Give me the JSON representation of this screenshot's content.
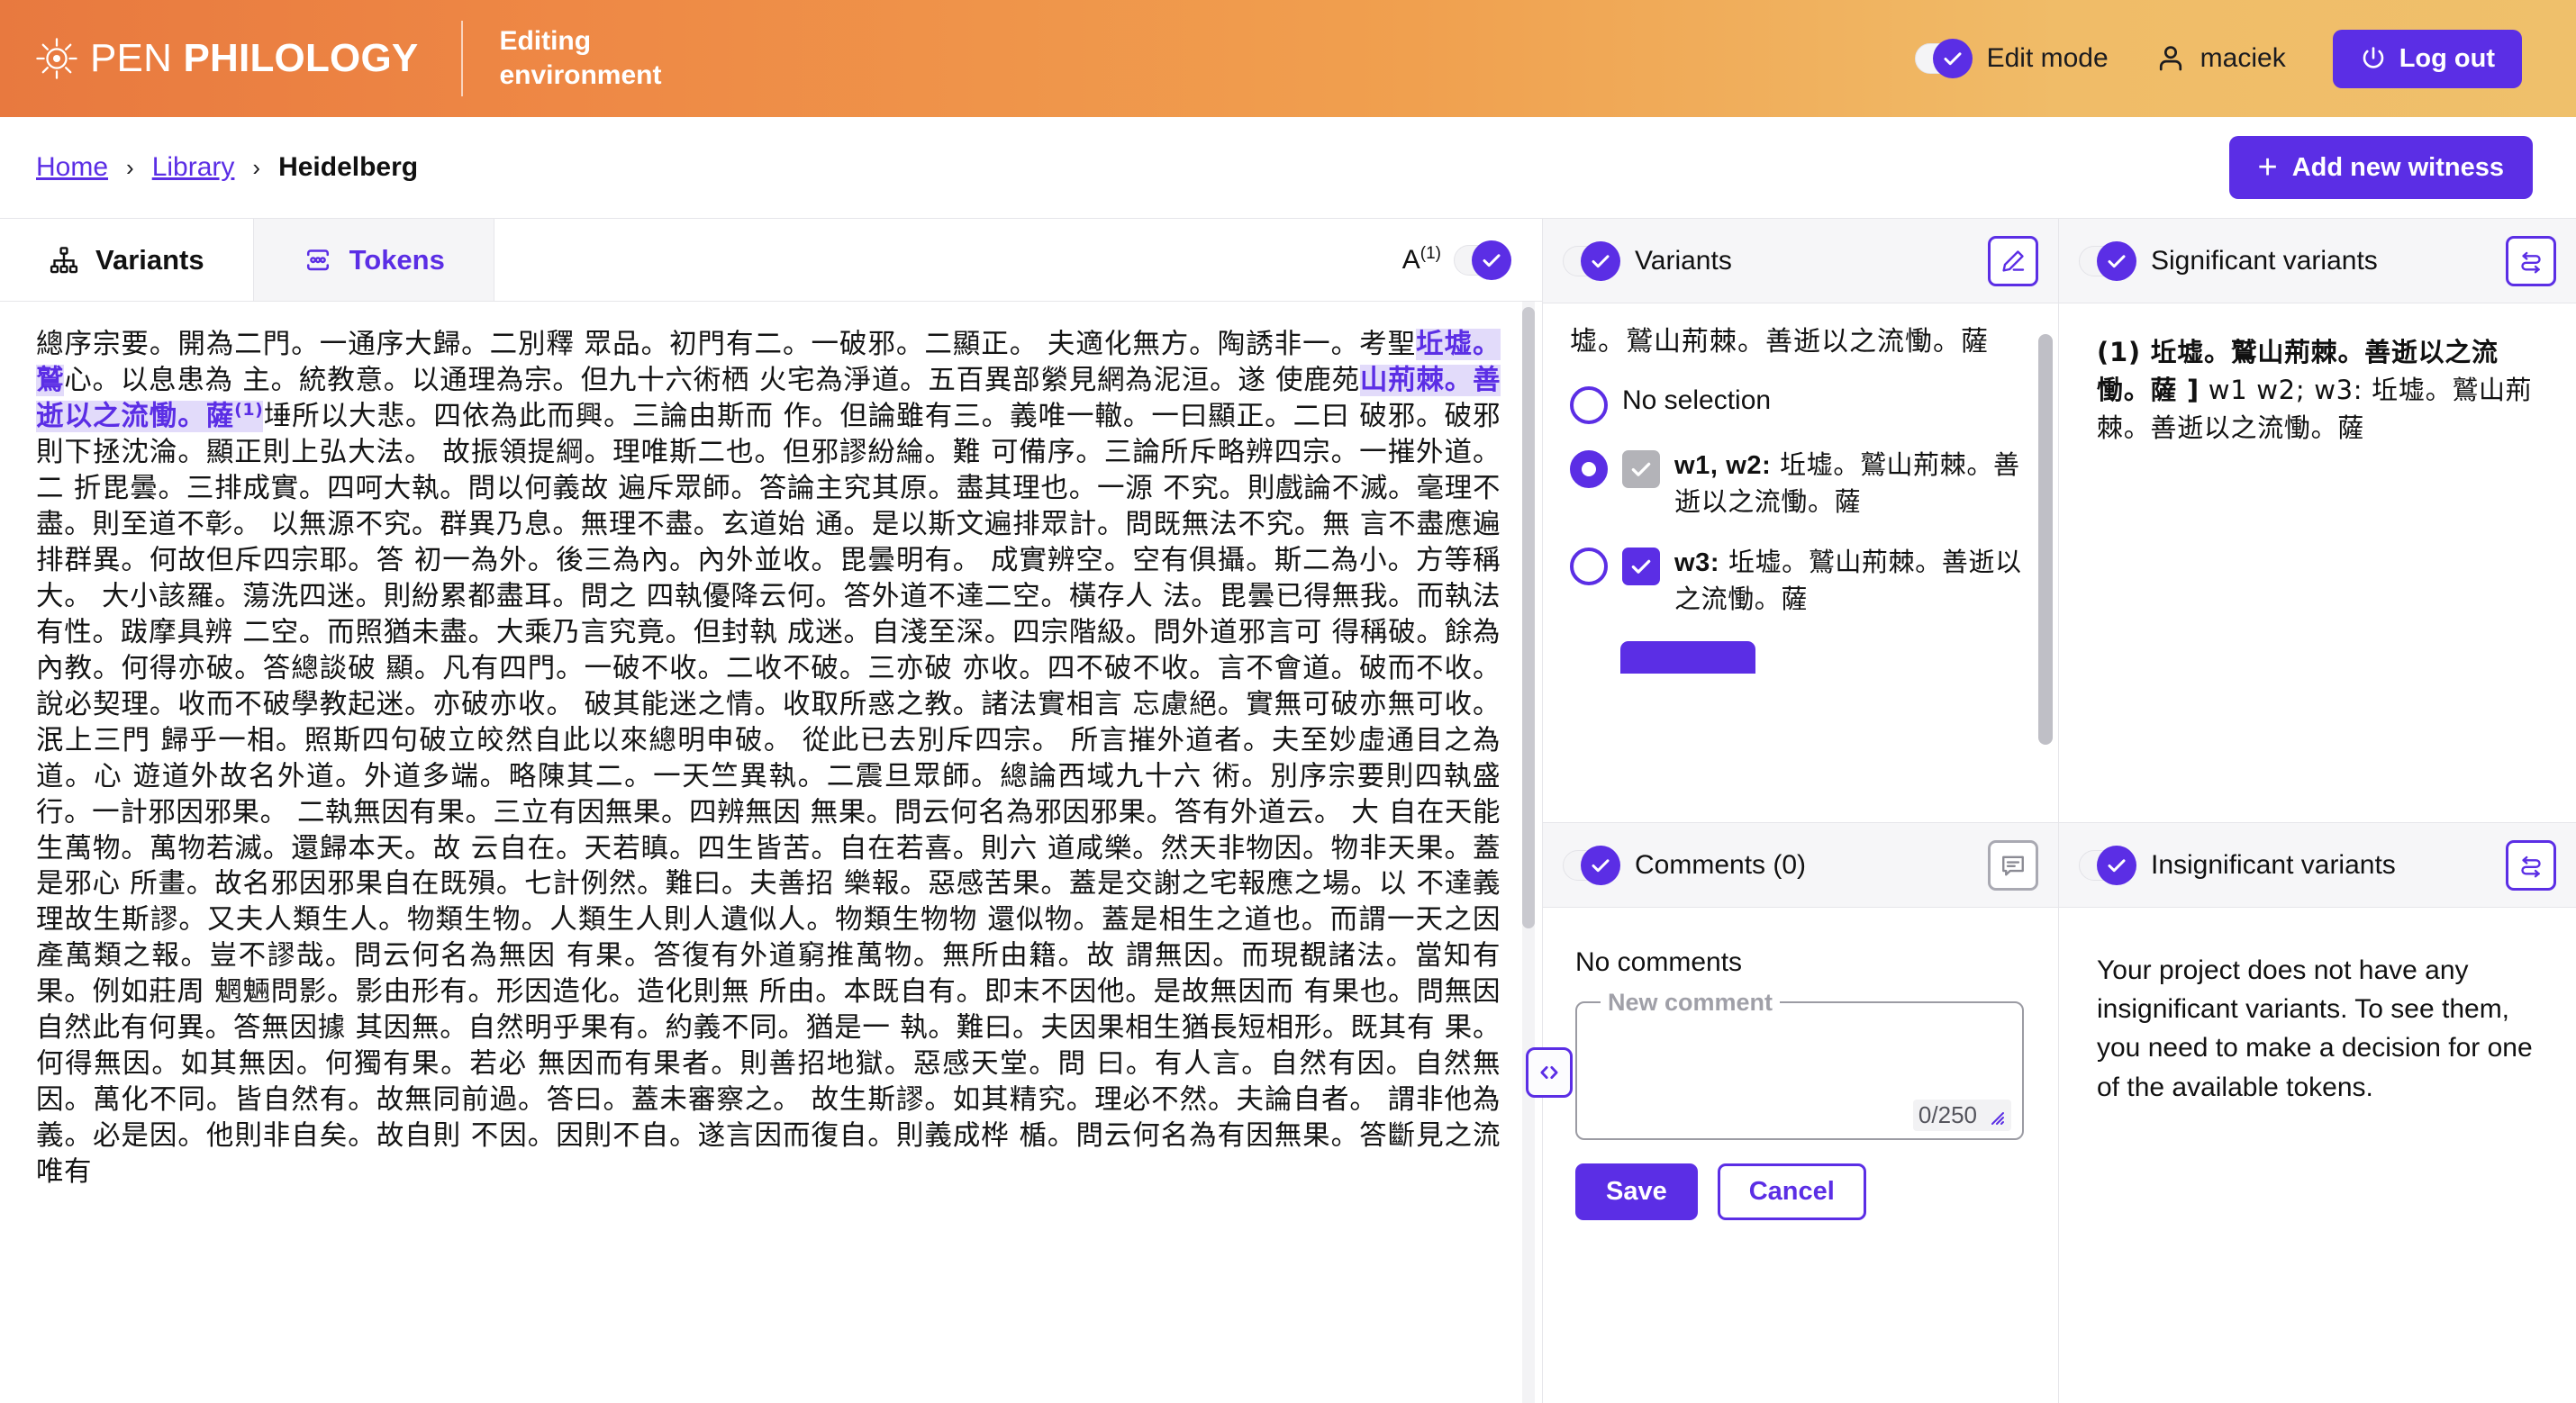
{
  "header": {
    "logo_open": "PEN ",
    "logo_philology": "PHILOLOGY",
    "logo_icon": "sun-asterisk-icon",
    "subtitle": "Editing environment",
    "edit_mode_label": "Edit mode",
    "edit_mode_on": true,
    "username": "maciek",
    "logout_label": "Log out",
    "accent_purple": "#5B2EE5",
    "gradient_start": "#e8793f",
    "gradient_end": "#efc06b"
  },
  "breadcrumb": {
    "items": [
      {
        "label": "Home",
        "current": false
      },
      {
        "label": "Library",
        "current": false
      },
      {
        "label": "Heidelberg",
        "current": true
      }
    ],
    "separator": "›",
    "add_witness_label": "Add new witness"
  },
  "tabs": {
    "items": [
      {
        "label": "Variants",
        "icon": "hierarchy-icon",
        "active": true
      },
      {
        "label": "Tokens",
        "icon": "tokens-icon",
        "active": false
      }
    ],
    "apparatus_label": "A",
    "apparatus_sup": "(1)",
    "apparatus_toggle_on": true
  },
  "main_text": {
    "lines": [
      "總序宗要。開為二門。一通序大歸。二別釋 眾品。初門有二。一破邪。二顯正。 夫適化無方。陶誘非一。考聖",
      "心。以息患為 主。統教意。以通理為宗。但九十六術栖 火宅為淨道。五百異部縈見網為泥洹。遂 使鹿苑",
      "埵所以大悲。四依為此而興。三論由斯而 作。但論雖有三。義唯一轍。一曰顯正。",
      "二曰 破邪。破邪則下拯沈淪。顯正則上弘大法。 故振領提綱。理唯斯二也。但邪謬紛綸。難 可備序。三論所斥略",
      "辨四宗。一摧外道。二 折毘曇。三排成實。四呵大執。問以何義故 遍斥眾師。答論主究其原。盡其理也。一源 不",
      "究。則戲論不滅。毫理不盡。則至道不彰。 以無源不究。群異乃息。無理不盡。玄道始 通。是以斯文遍排眾計。",
      "問既無法不究。無 言不盡應遍排群異。何故但斥四宗耶。答 初一為外。後三為內。內外並收。毘曇明有。 成實辨",
      "空。空有俱攝。斯二為小。方等稱大。 大小該羅。蕩洗四迷。則紛累都盡耳。問之 四執優降云何。答外道不達",
      "二空。橫存人 法。毘曇已得無我。而執法有性。跋摩具辨 二空。而照猶未盡。大乘乃言究竟。但封執 成迷。自淺",
      "至深。四宗階級。問外道邪言可 得稱破。餘為內教。何得亦破。答總談破 顯。凡有四門。一破不收。二收不破。",
      "三亦破 亦收。四不破不收。言不會道。破而不收。 說必契理。收而不破學教起迷。亦破亦收。 破其能迷之情。收",
      "取所惑之教。諸法實相言 忘慮絕。實無可破亦無可收。泯上三門 歸乎一相。照斯四句破立皎然自此以來總明申",
      "破。 從此已去別斥四宗。 所言摧外道者。夫至妙虛通目之為道。心 遊道外故名外道。外道多端。略陳其二。一",
      "天竺異執。二震旦眾師。總論西域九十六 術。別序宗要則四執盛行。一計邪因邪果。 二執無因有果。三立有因無",
      "果。四辨無因 無果。問云何名為邪因邪果。答有外道云。 大 自在天能生萬物。萬物若滅。還歸本天。故 云自在。",
      "天若瞋。四生皆苦。自在若喜。則六 道咸樂。然天非物因。物非天果。蓋是邪心 所畫。故名邪因邪果自在既殞。",
      "七計例然。難曰。夫善招 樂報。惡感苦果。蓋是交謝之宅報應之場。以 不達義理故生斯謬。又夫人類生人。物類",
      "生物。人類生人則人遺似人。物類生物物 還似物。蓋是相生之道也。而謂一天之因 產萬類之報。豈不謬哉。問云",
      "何名為無因 有果。答復有外道窮推萬物。無所由籍。故 謂無因。而現覩諸法。當知有果。例如莊周 魍魎問影。影",
      "由形有。形因造化。造化則無 所由。本既自有。即末不因他。是故無因而 有果也。問無因自然此有何異。答無因",
      "據 其因無。自然明乎果有。約義不同。猶是一 執。難曰。夫因果相生猶長短相形。既其有 果。何得無因。如其無",
      "因。何獨有果。若必 無因而有果者。則善招地獄。惡感天堂。問 曰。有人言。自然有因。自然無因。萬化不同。",
      "皆自然有。故無同前過。答曰。蓋未審察之。 故生斯謬。如其精究。理必不然。夫論自者。 謂非他為義。必是",
      "因。他則非自矣。故自則 不因。因則不自。遂言因而復自。則義成桦 楯。問云何名為有因無果。答斷見之流唯有"
    ],
    "highlight": {
      "text_a": "坵墟。鷲",
      "text_b": "山荊棘。善逝以之流慟。薩",
      "marker": "(1)",
      "bg": "#e2dbfa",
      "fg": "#5B2EE5"
    }
  },
  "splitter": {
    "icon": "code-collapse-icon"
  },
  "panels": {
    "variants": {
      "title": "Variants",
      "toggle_on": true,
      "action_icon": "pencil-edit-icon",
      "lead_text": "墟。鷲山荊棘。善逝以之流慟。薩",
      "options": [
        {
          "label": "No selection",
          "selected": false,
          "has_checkbox": false
        },
        {
          "label": "w1, w2:",
          "text": " 坵墟。鷲山荊棘。善逝以之流慟。薩",
          "selected": true,
          "has_checkbox": true,
          "checkbox_state": "grey"
        },
        {
          "label": "w3:",
          "text": " 坵墟。鷲山荊棘。善逝以之流慟。薩",
          "selected": false,
          "has_checkbox": true,
          "checkbox_state": "purple"
        }
      ]
    },
    "comments": {
      "title": "Comments (0)",
      "toggle_on": true,
      "action_icon": "comment-bubble-icon",
      "empty_text": "No comments",
      "field_legend": "New comment",
      "field_value": "",
      "counter": "0/250",
      "save_label": "Save",
      "cancel_label": "Cancel"
    },
    "significant": {
      "title": "Significant variants",
      "toggle_on": true,
      "action_icon": "swap-arrows-icon",
      "entry_bold": "(1) 坵墟。鷲山荊棘。善逝以之流慟。薩 ]",
      "entry_rest": " w1 w2; w3: 坵墟。鷲山荊棘。善逝以之流慟。薩"
    },
    "insignificant": {
      "title": "Insignificant variants",
      "toggle_on": true,
      "action_icon": "swap-arrows-icon",
      "empty_text": "Your project does not have any insignificant variants. To see them, you need to make a decision for one of the available tokens."
    }
  }
}
